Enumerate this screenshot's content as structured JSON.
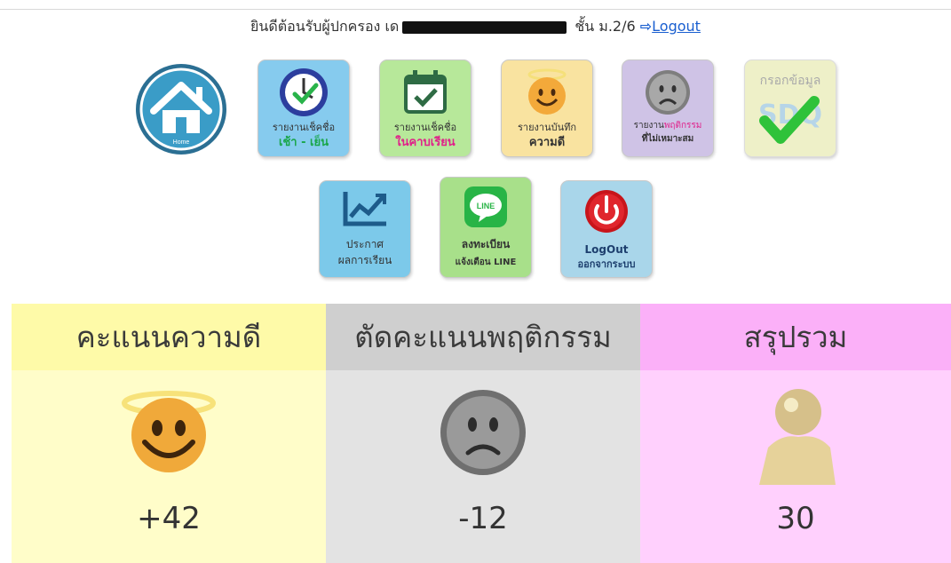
{
  "header": {
    "welcome_prefix": "ยินดีต้อนรับผู้ปกครอง",
    "welcome_initial": "เด",
    "welcome_suffix": "ชั้น ม.2/6",
    "logout_label": "Logout"
  },
  "menu": {
    "home": {
      "label": "Home"
    },
    "attendance": {
      "line1": "รายงานเช็คชื่อ",
      "line2": "เช้า - เย็น",
      "accent": "#1aa64a",
      "bg": "#86cbee"
    },
    "class_check": {
      "line1": "รายงานเช็คชื่อ",
      "line2": "ในคาบเรียน",
      "accent": "#e0218a",
      "bg": "#b7e89a"
    },
    "good_deeds": {
      "line1": "รายงานบันทึก",
      "line2": "ความดี",
      "accent": "#333333",
      "bg": "#f9e3a0"
    },
    "bad_behavior": {
      "line1_a": "รายงาน",
      "line1_b": "พฤติกรรม",
      "line2": "ที่ไม่เหมาะสม",
      "accent": "#e0218a",
      "bg": "#cfc3e6"
    },
    "sdq": {
      "line1": "กรอกข้อมูล",
      "watermark": "SDQ",
      "bg": "#eef0c8"
    },
    "grades": {
      "line1": "ประกาศ",
      "line2": "ผลการเรียน",
      "bg": "#7cc9ea"
    },
    "line_notify": {
      "line1": "ลงทะเบียน",
      "line2": "แจ้งเตือน LINE",
      "icon_text": "LINE",
      "bg": "#a8e08a"
    },
    "logout_tile": {
      "line1": "LogOut",
      "line2": "ออกจากระบบ",
      "bg": "#a9d6ea"
    }
  },
  "summary": {
    "good": {
      "title": "คะแนนความดี",
      "score": "+42",
      "head_bg": "#fefaa8",
      "body_bg": "#fffdc9"
    },
    "deduct": {
      "title": "ตัดคะแนนพฤติกรรม",
      "score": "-12",
      "head_bg": "#cfcfcf",
      "body_bg": "#e3e3e3"
    },
    "total": {
      "title": "สรุปรวม",
      "score": "30",
      "head_bg": "#fbb0f8",
      "body_bg": "#ffd0fd"
    }
  }
}
